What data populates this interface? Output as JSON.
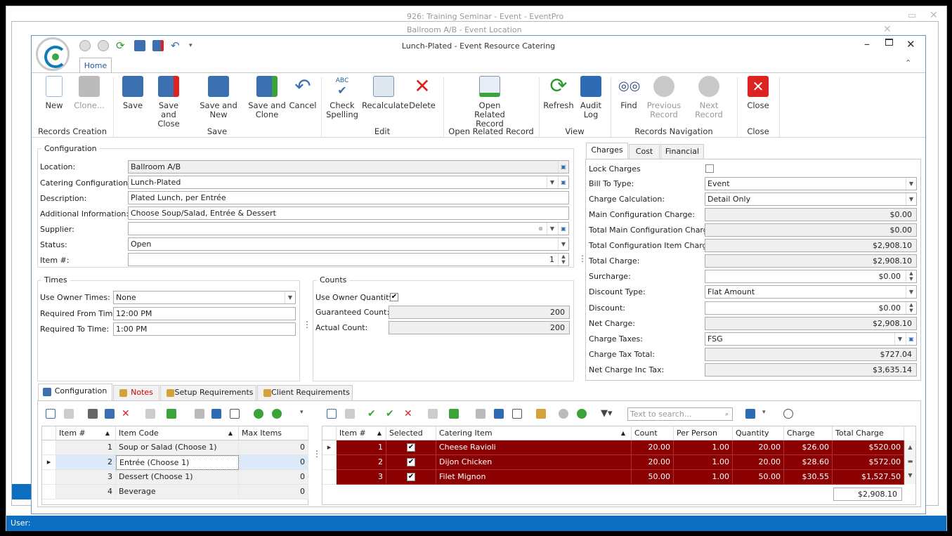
{
  "back_windows": {
    "win1_title": "926: Training Seminar - Event - EventPro",
    "win2_title": "Ballroom A/B - Event Location",
    "status_label": "User:"
  },
  "window": {
    "title": "Lunch-Plated - Event Resource Catering",
    "ribbon_tab": "Home"
  },
  "ribbon": {
    "buttons": [
      {
        "label": "New"
      },
      {
        "label": "Clone..."
      },
      {
        "label": "Save"
      },
      {
        "label": "Save and Close"
      },
      {
        "label": "Save and New"
      },
      {
        "label": "Save and Clone"
      },
      {
        "label": "Cancel"
      },
      {
        "label": "Check Spelling"
      },
      {
        "label": "Recalculate"
      },
      {
        "label": "Delete"
      },
      {
        "label": "Open Related Record"
      },
      {
        "label": "Refresh"
      },
      {
        "label": "Audit Log"
      },
      {
        "label": "Find"
      },
      {
        "label": "Previous Record"
      },
      {
        "label": "Next Record"
      },
      {
        "label": "Close"
      }
    ],
    "groups": [
      "Records Creation",
      "Save",
      "Edit",
      "Open Related Record",
      "View",
      "Records Navigation",
      "Close"
    ]
  },
  "configuration": {
    "title": "Configuration",
    "location_label": "Location:",
    "location": "Ballroom A/B",
    "catering_label": "Catering Configuration:*",
    "catering": "Lunch-Plated",
    "description_label": "Description:",
    "description": "Plated Lunch, per Entrée",
    "additional_label": "Additional Information:",
    "additional": "Choose Soup/Salad, Entrée & Dessert",
    "supplier_label": "Supplier:",
    "supplier": "",
    "status_label": "Status:",
    "status": "Open",
    "item_label": "Item #:",
    "item": "1"
  },
  "times": {
    "title": "Times",
    "use_owner_label": "Use Owner Times:",
    "use_owner": "None",
    "from_label": "Required From Time:",
    "from": "12:00 PM",
    "to_label": "Required To Time:",
    "to": "1:00 PM"
  },
  "counts": {
    "title": "Counts",
    "use_owner_qty_label": "Use Owner Quantity",
    "guaranteed_label": "Guaranteed Count:",
    "guaranteed": "200",
    "actual_label": "Actual Count:",
    "actual": "200"
  },
  "charges": {
    "tabs": [
      "Charges",
      "Cost",
      "Financial"
    ],
    "lock_label": "Lock Charges",
    "bill_label": "Bill To Type:",
    "bill": "Event",
    "calc_label": "Charge Calculation:",
    "calc": "Detail Only",
    "main_label": "Main Configuration Charge:",
    "main": "$0.00",
    "total_main_label": "Total Main Configuration Charge:",
    "total_main": "$0.00",
    "total_item_label": "Total Configuration Item Charge:",
    "total_item": "$2,908.10",
    "total_label": "Total Charge:",
    "total": "$2,908.10",
    "surcharge_label": "Surcharge:",
    "surcharge": "$0.00",
    "disc_type_label": "Discount Type:",
    "disc_type": "Flat Amount",
    "discount_label": "Discount:",
    "discount": "$0.00",
    "net_label": "Net Charge:",
    "net": "$2,908.10",
    "taxes_label": "Charge Taxes:",
    "taxes": "FSG",
    "tax_total_label": "Charge Tax Total:",
    "tax_total": "$727.04",
    "net_inc_label": "Net Charge Inc Tax:",
    "net_inc": "$3,635.14"
  },
  "bottom_tabs": [
    "Configuration",
    "Notes",
    "Setup Requirements",
    "Client Requirements"
  ],
  "left_grid": {
    "headers": [
      "Item #",
      "Item Code",
      "Max Items"
    ],
    "rows": [
      {
        "num": "1",
        "code": "Soup or Salad (Choose 1)",
        "max": "0"
      },
      {
        "num": "2",
        "code": "Entrée (Choose 1)",
        "max": "0"
      },
      {
        "num": "3",
        "code": "Dessert (Choose 1)",
        "max": "0"
      },
      {
        "num": "4",
        "code": "Beverage",
        "max": "0"
      }
    ]
  },
  "right_grid": {
    "search_placeholder": "Text to search...",
    "headers": [
      "Item #",
      "Selected",
      "Catering Item",
      "Count",
      "Per Person",
      "Quantity",
      "Charge",
      "Total Charge"
    ],
    "rows": [
      {
        "num": "1",
        "item": "Cheese Ravioli",
        "count": "20.00",
        "pp": "1.00",
        "qty": "20.00",
        "charge": "$26.00",
        "total": "$520.00"
      },
      {
        "num": "2",
        "item": "Dijon Chicken",
        "count": "20.00",
        "pp": "1.00",
        "qty": "20.00",
        "charge": "$28.60",
        "total": "$572.00"
      },
      {
        "num": "3",
        "item": "Filet Mignon",
        "count": "50.00",
        "pp": "1.00",
        "qty": "50.00",
        "charge": "$30.55",
        "total": "$1,527.50"
      }
    ],
    "footer_total": "$2,908.10"
  }
}
